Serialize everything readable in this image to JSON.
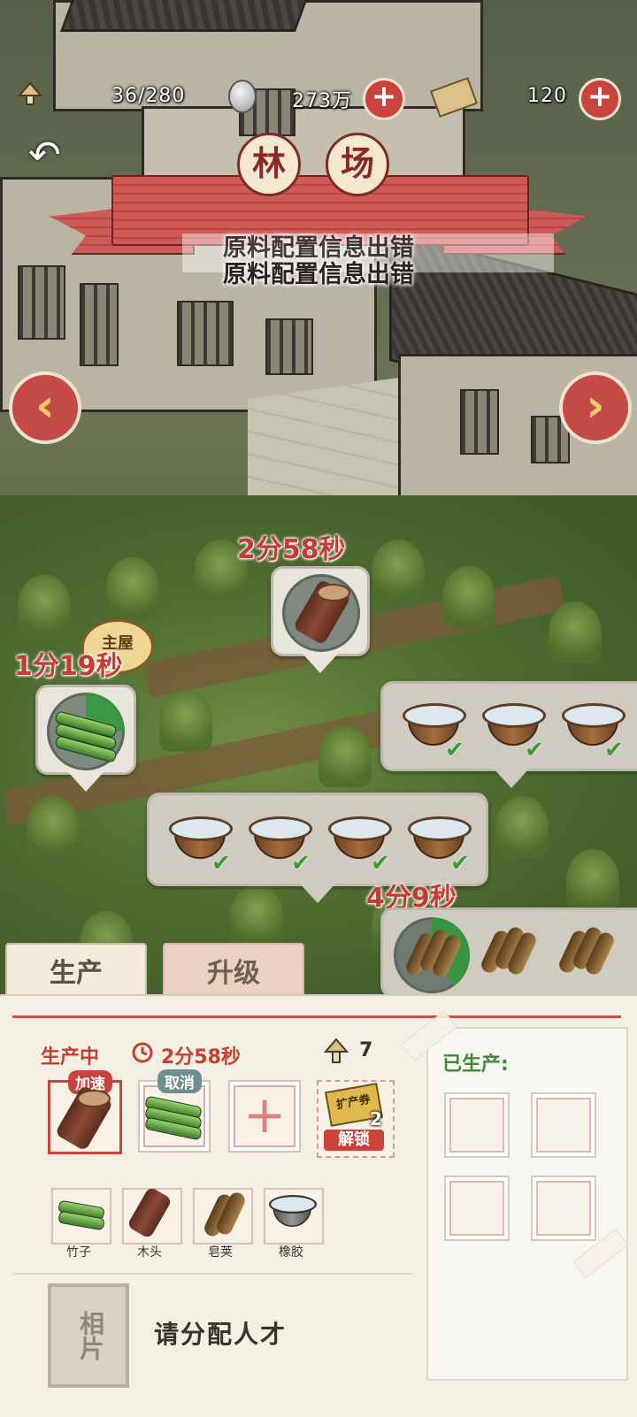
{
  "hud": {
    "population": "36/280",
    "silver": "273万",
    "tickets": "120"
  },
  "banner": {
    "title_char_1": "林",
    "title_char_2": "场",
    "error_line_1": "原料配置信息出错",
    "error_line_2": "原料配置信息出错"
  },
  "field": {
    "timer_wood": "2分58秒",
    "timer_bamboo": "1分19秒",
    "timer_pods": "4分9秒",
    "main_house_tag": "主屋"
  },
  "tabs": {
    "production": "生产",
    "upgrade": "升级"
  },
  "production": {
    "status_label": "生产中",
    "time": "2分58秒",
    "worker_count": "7",
    "speedup_badge": "加速",
    "cancel_badge": "取消",
    "expand_ticket_label": "扩产券",
    "expand_ticket_count": "2",
    "unlock_label": "解锁",
    "produced_label": "已生产:"
  },
  "materials": [
    {
      "name": "竹子",
      "icon": "bamboo-icon"
    },
    {
      "name": "木头",
      "icon": "log-icon"
    },
    {
      "name": "皂荚",
      "icon": "pod-icon"
    },
    {
      "name": "橡胶",
      "icon": "rubber-bowl-icon"
    }
  ],
  "staff": {
    "photo_label": "相片",
    "assign_prompt": "请分配人才"
  },
  "colors": {
    "accent_red": "#c9433d",
    "panel_bg": "#f4efe3",
    "timer_red": "#c73a34",
    "check_green": "#3d9a38"
  }
}
